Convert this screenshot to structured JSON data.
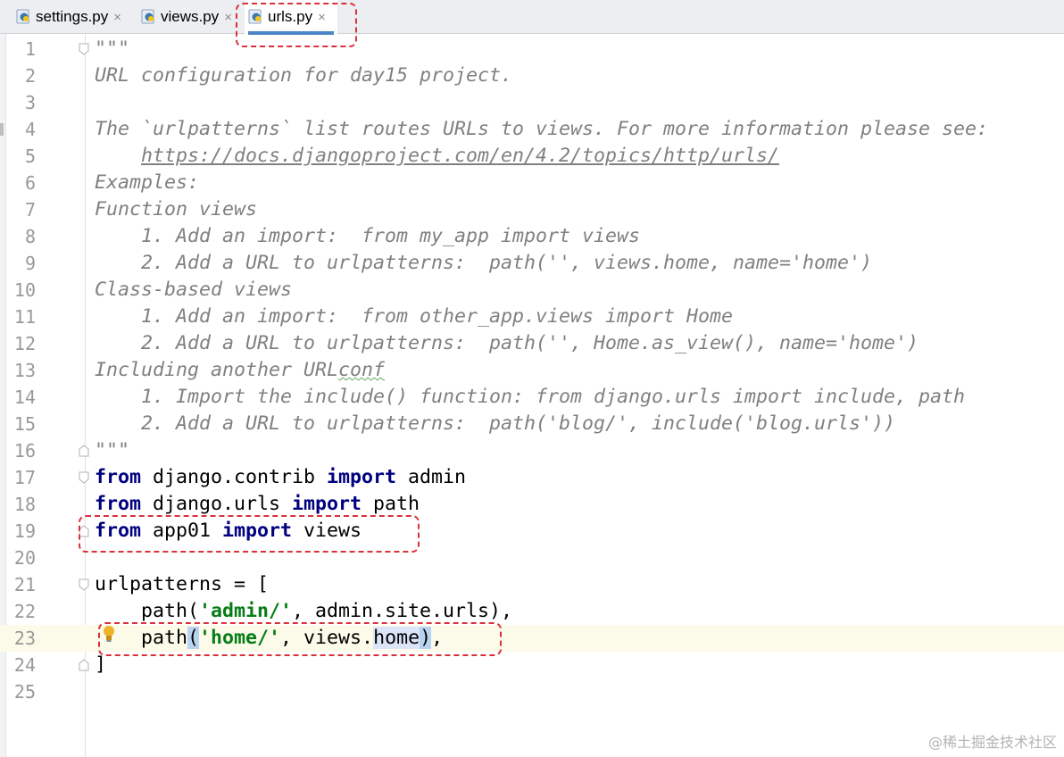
{
  "tabs": [
    {
      "name": "settings.py",
      "active": false
    },
    {
      "name": "views.py",
      "active": false
    },
    {
      "name": "urls.py",
      "active": true
    }
  ],
  "close_glyph": "×",
  "watermark": "@稀土掘金技术社区",
  "current_line": 23,
  "lines": [
    {
      "n": "1",
      "segs": [
        {
          "t": "\"\"\"",
          "c": "doc"
        }
      ]
    },
    {
      "n": "2",
      "segs": [
        {
          "t": "URL configuration for day15 project.",
          "c": "doc"
        }
      ]
    },
    {
      "n": "3",
      "segs": []
    },
    {
      "n": "4",
      "segs": [
        {
          "t": "The `urlpatterns` list routes URLs to views. For more information please see:",
          "c": "doc"
        }
      ]
    },
    {
      "n": "5",
      "segs": [
        {
          "t": "    ",
          "c": "doc"
        },
        {
          "t": "https://docs.djangoproject.com/en/4.2/topics/http/urls/",
          "c": "link"
        }
      ]
    },
    {
      "n": "6",
      "segs": [
        {
          "t": "Examples:",
          "c": "doc"
        }
      ]
    },
    {
      "n": "7",
      "segs": [
        {
          "t": "Function views",
          "c": "doc"
        }
      ]
    },
    {
      "n": "8",
      "segs": [
        {
          "t": "    1. Add an import:  from my_app import views",
          "c": "doc"
        }
      ]
    },
    {
      "n": "9",
      "segs": [
        {
          "t": "    2. Add a URL to urlpatterns:  path('', views.home, name='home')",
          "c": "doc"
        }
      ]
    },
    {
      "n": "10",
      "segs": [
        {
          "t": "Class-based views",
          "c": "doc"
        }
      ]
    },
    {
      "n": "11",
      "segs": [
        {
          "t": "    1. Add an import:  from other_app.views import Home",
          "c": "doc"
        }
      ]
    },
    {
      "n": "12",
      "segs": [
        {
          "t": "    2. Add a URL to urlpatterns:  path('', Home.as_view(), name='home')",
          "c": "doc"
        }
      ]
    },
    {
      "n": "13",
      "segs": [
        {
          "t": "Including another URL",
          "c": "doc"
        },
        {
          "t": "conf",
          "c": "doc squig"
        }
      ]
    },
    {
      "n": "14",
      "segs": [
        {
          "t": "    1. Import the include() function: from django.urls import include, path",
          "c": "doc"
        }
      ]
    },
    {
      "n": "15",
      "segs": [
        {
          "t": "    2. Add a URL to urlpatterns:  path('blog/', include('blog.urls'))",
          "c": "doc"
        }
      ]
    },
    {
      "n": "16",
      "segs": [
        {
          "t": "\"\"\"",
          "c": "doc"
        }
      ]
    },
    {
      "n": "17",
      "segs": [
        {
          "t": "from",
          "c": "kw"
        },
        {
          "t": " django.contrib ",
          "c": ""
        },
        {
          "t": "import",
          "c": "kw"
        },
        {
          "t": " admin",
          "c": ""
        }
      ]
    },
    {
      "n": "18",
      "segs": [
        {
          "t": "from",
          "c": "kw"
        },
        {
          "t": " django.urls ",
          "c": ""
        },
        {
          "t": "import",
          "c": "kw"
        },
        {
          "t": " path",
          "c": ""
        }
      ]
    },
    {
      "n": "19",
      "segs": [
        {
          "t": "from",
          "c": "kw"
        },
        {
          "t": " app01 ",
          "c": ""
        },
        {
          "t": "import",
          "c": "kw"
        },
        {
          "t": " views",
          "c": ""
        }
      ]
    },
    {
      "n": "20",
      "segs": []
    },
    {
      "n": "21",
      "segs": [
        {
          "t": "urlpatterns = [",
          "c": ""
        }
      ]
    },
    {
      "n": "22",
      "segs": [
        {
          "t": "    path(",
          "c": ""
        },
        {
          "t": "'admin/'",
          "c": "str"
        },
        {
          "t": ", admin.site.urls),",
          "c": ""
        }
      ]
    },
    {
      "n": "23",
      "segs": [
        {
          "t": "    path",
          "c": ""
        },
        {
          "t": "(",
          "c": "hlbr"
        },
        {
          "t": "'home/'",
          "c": "str"
        },
        {
          "t": ", views.",
          "c": ""
        },
        {
          "t": "home",
          "c": "hl"
        },
        {
          "t": ")",
          "c": "hlbr"
        },
        {
          "t": ",",
          "c": ""
        }
      ]
    },
    {
      "n": "24",
      "segs": [
        {
          "t": "]",
          "c": ""
        }
      ]
    },
    {
      "n": "25",
      "segs": []
    }
  ]
}
